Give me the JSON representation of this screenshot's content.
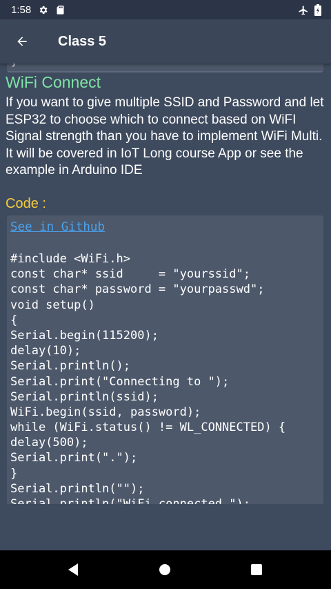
{
  "status_bar": {
    "time": "1:58",
    "icons": [
      "settings-icon",
      "sd-card-icon",
      "airplane-mode-icon",
      "battery-icon"
    ]
  },
  "app_bar": {
    "title": "Class 5",
    "back_icon": "arrow-back-icon"
  },
  "content": {
    "previous_code_tail": "}",
    "section_title": "WiFi Connect",
    "section_text": "If you want to give multiple SSID and Password and let ESP32 to choose which to connect based on WiFI Signal strength than you have to implement WiFi Multi. It will be covered in IoT Long course App or see the example in Arduino IDE",
    "code_label": "Code :",
    "github_link": "See in Github",
    "code_lines": [
      "#include <WiFi.h>",
      "const char* ssid     = \"yourssid\";",
      "const char* password = \"yourpasswd\";",
      "void setup()",
      "{",
      "Serial.begin(115200);",
      "delay(10);",
      "Serial.println();",
      "Serial.print(\"Connecting to \");",
      "Serial.println(ssid);",
      "WiFi.begin(ssid, password);",
      "while (WiFi.status() != WL_CONNECTED) {",
      "delay(500);",
      "Serial.print(\".\");",
      "}",
      "Serial.println(\"\");",
      "Serial.println(\"WiFi connected.\");"
    ]
  },
  "colors": {
    "background": "#3e4a5e",
    "app_bar": "#3b4658",
    "status_bar": "#2c3547",
    "code_box": "#4d586b",
    "section_title": "#7ee3a7",
    "code_label": "#f4cd3b",
    "link": "#4aa3ee"
  },
  "nav_bar": {
    "icons": [
      "back-triangle-icon",
      "home-circle-icon",
      "recents-square-icon"
    ]
  }
}
